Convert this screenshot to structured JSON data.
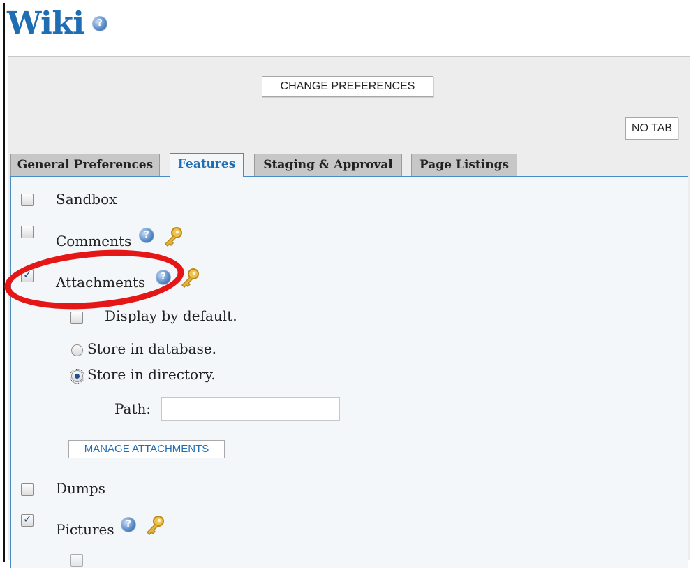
{
  "page": {
    "title": "Wiki"
  },
  "buttons": {
    "change_preferences": "CHANGE PREFERENCES",
    "no_tab": "NO TAB",
    "manage_attachments": "MANAGE ATTACHMENTS"
  },
  "tabs": [
    {
      "label": "General Preferences",
      "active": false
    },
    {
      "label": "Features",
      "active": true
    },
    {
      "label": "Staging & Approval",
      "active": false
    },
    {
      "label": "Page Listings",
      "active": false
    }
  ],
  "features": {
    "sandbox": {
      "label": "Sandbox",
      "checked": false
    },
    "comments": {
      "label": "Comments",
      "checked": false
    },
    "attachments": {
      "label": "Attachments",
      "checked": true,
      "display_default": {
        "label": "Display by default.",
        "checked": false
      },
      "store_database": {
        "label": "Store in database.",
        "selected": false
      },
      "store_directory": {
        "label": "Store in directory.",
        "selected": true
      },
      "path": {
        "label": "Path:",
        "value": ""
      }
    },
    "dumps": {
      "label": "Dumps",
      "checked": false
    },
    "pictures": {
      "label": "Pictures",
      "checked": true
    }
  },
  "icons": {
    "help": "help-icon",
    "permission_key": "key-icon"
  },
  "colors": {
    "title_blue": "#1f6db3",
    "annotation_red": "#e41616"
  }
}
